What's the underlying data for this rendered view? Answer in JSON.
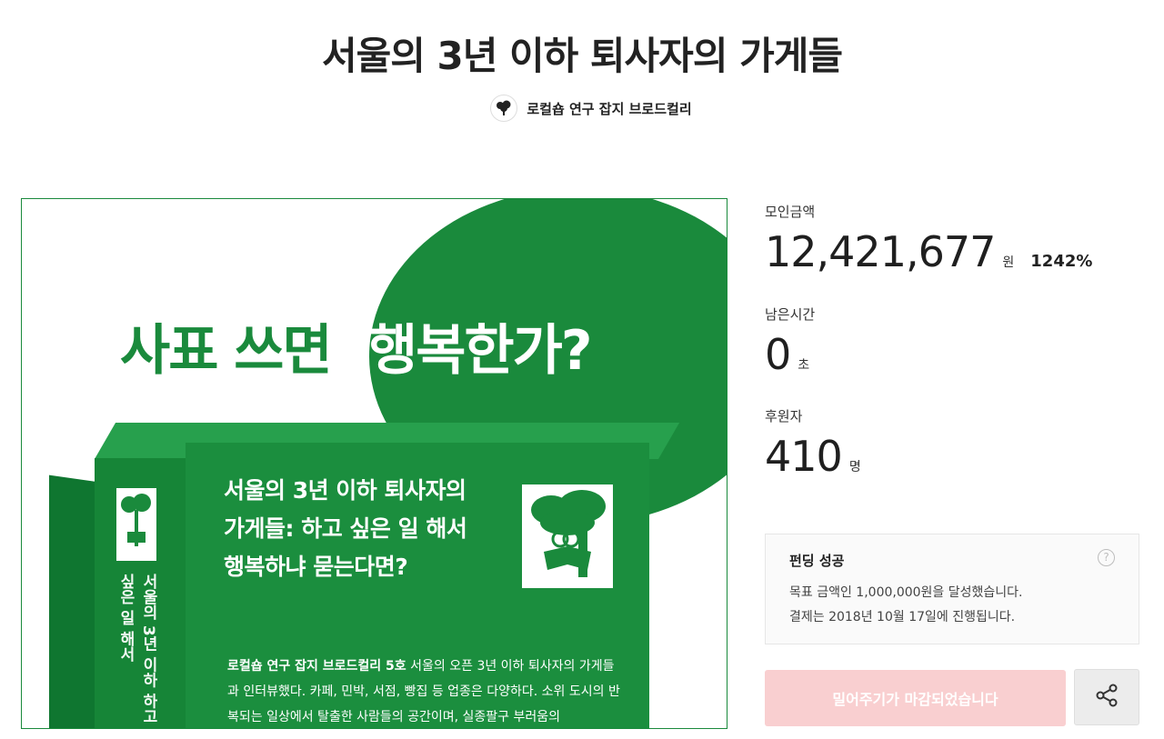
{
  "title": "서울의 3년 이하 퇴사자의 가게들",
  "creator": {
    "name": "로컬숍 연구 잡지 브로드컬리",
    "icon": "tree-logo-icon"
  },
  "hero": {
    "headline_green": "사표 쓰면",
    "headline_white": "행복한가?",
    "cover_title_lines": [
      "서울의 3년 이하 퇴사자의",
      "가게들: 하고 싶은 일 해서",
      "행복하냐 묻는다면?"
    ],
    "spine_text": "서울의 3년 이하 하고 싶은 일 해서",
    "blurb_bold": "로컬숍 연구 잡지 브로드컬리 5호",
    "blurb_rest": " 서울의 오픈 3년 이하 퇴사자의 가게들과 인터뷰했다. 카페, 민박, 서점, 빵집 등 업종은 다양하다. 소위 도시의 반복되는 일상에서 탈출한 사람들의 공간이며, 실종팔구 부러움의",
    "colors": {
      "green": "#1a8a3c"
    }
  },
  "stats": {
    "amount_label": "모인금액",
    "amount_value": "12,421,677",
    "amount_unit": "원",
    "amount_percent": "1242%",
    "time_label": "남은시간",
    "time_value": "0",
    "time_unit": "초",
    "backers_label": "후원자",
    "backers_value": "410",
    "backers_unit": "명"
  },
  "notice": {
    "title": "펀딩 성공",
    "line1": "목표 금액인 1,000,000원을 달성했습니다.",
    "line2": "결제는 2018년 10월 17일에 진행됩니다.",
    "help_icon": "question-icon"
  },
  "cta": {
    "label": "밀어주기가 마감되었습니다",
    "color": "#f9cfd0"
  },
  "share": {
    "icon": "share-icon"
  }
}
